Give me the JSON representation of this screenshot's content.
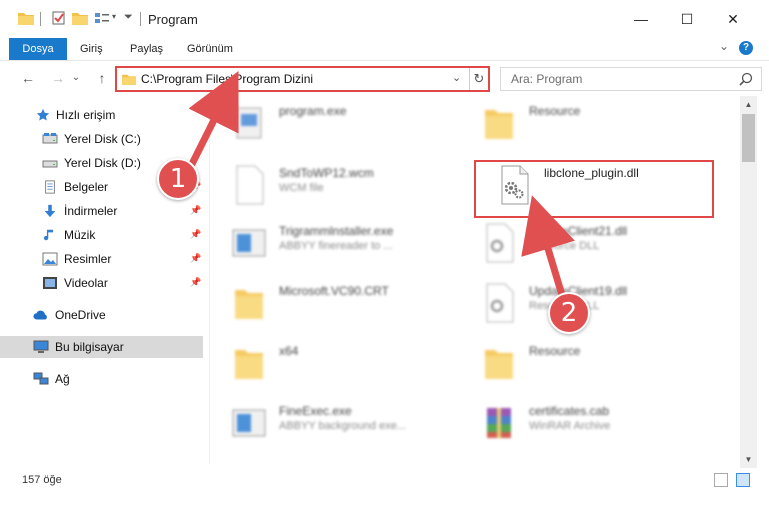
{
  "window": {
    "title": "Program",
    "minimize": "—",
    "maximize": "☐",
    "close": "✕"
  },
  "ribbon": {
    "tabs": [
      "Dosya",
      "Giriş",
      "Paylaş",
      "Görünüm"
    ],
    "collapse": "⌄",
    "help": "?"
  },
  "nav": {
    "back": "←",
    "forward": "→",
    "recent": "⌄",
    "up": "↑",
    "address": "C:\\Program Files\\Program Dizini",
    "address_dropdown": "⌄",
    "refresh": "↻",
    "search_placeholder": "Ara: Program"
  },
  "sidebar": {
    "items": [
      {
        "label": "Hızlı erişim",
        "icon": "star-icon"
      },
      {
        "label": "Yerel Disk (C:)",
        "icon": "drive-icon"
      },
      {
        "label": "Yerel Disk (D:)",
        "icon": "drive-icon"
      },
      {
        "label": "Belgeler",
        "icon": "documents-icon"
      },
      {
        "label": "İndirmeler",
        "icon": "download-icon"
      },
      {
        "label": "Müzik",
        "icon": "music-icon"
      },
      {
        "label": "Resimler",
        "icon": "pictures-icon"
      },
      {
        "label": "Videolar",
        "icon": "video-icon"
      },
      {
        "label": "OneDrive",
        "icon": "cloud-icon"
      },
      {
        "label": "Bu bilgisayar",
        "icon": "computer-icon"
      },
      {
        "label": "Ağ",
        "icon": "network-icon"
      }
    ]
  },
  "files": [
    {
      "name": "program.exe",
      "sub": ""
    },
    {
      "name": "Resource",
      "sub": ""
    },
    {
      "name": "SndToWP12.wcm",
      "sub": "WCM file"
    },
    {
      "name": "libclone_plugin.dll",
      "sub": ""
    },
    {
      "name": "Trigrammlnstaller.exe",
      "sub": "ABBYY finereader to ..."
    },
    {
      "name": "UpdateClient21.dll",
      "sub": "Resource DLL"
    },
    {
      "name": "Microsoft.VC90.CRT",
      "sub": ""
    },
    {
      "name": "UpdateClient19.dll",
      "sub": "Resource DLL"
    },
    {
      "name": "x64",
      "sub": ""
    },
    {
      "name": "Resource",
      "sub": ""
    },
    {
      "name": "FineExec.exe",
      "sub": "ABBYY background exe..."
    },
    {
      "name": "certificates.cab",
      "sub": "WinRAR Archive"
    }
  ],
  "steps": [
    "1",
    "2"
  ],
  "status": {
    "count": "157 öğe"
  },
  "colors": {
    "accent": "#1979ca",
    "highlight": "#e04848",
    "selected": "#d9d9d9"
  }
}
